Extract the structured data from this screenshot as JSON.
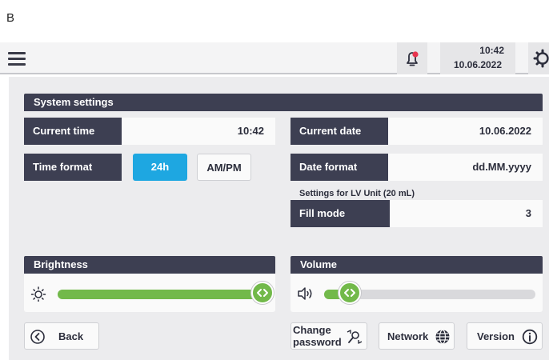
{
  "figure_label": "B",
  "header": {
    "time": "10:42",
    "date": "10.06.2022",
    "icons": [
      "menu-icon",
      "notification-bell-icon",
      "settings-gear-icon"
    ],
    "alert_color": "#e8344e"
  },
  "system_settings": {
    "title": "System settings",
    "current_time_label": "Current time",
    "current_time_value": "10:42",
    "current_date_label": "Current date",
    "current_date_value": "10.06.2022",
    "time_format_label": "Time format",
    "time_format_options": [
      "24h",
      "AM/PM"
    ],
    "time_format_selected": "24h",
    "date_format_label": "Date format",
    "date_format_value": "dd.MM.yyyy",
    "lv_note": "Settings for LV Unit (20 mL)",
    "fill_mode_label": "Fill mode",
    "fill_mode_value": "3"
  },
  "brightness": {
    "title": "Brightness",
    "level": 0.97,
    "icon": "sun-icon"
  },
  "volume": {
    "title": "Volume",
    "level": 0.12,
    "icon": "speaker-icon"
  },
  "footer": {
    "back_label": "Back",
    "change_password_line1": "Change",
    "change_password_line2": "password",
    "network_label": "Network",
    "version_label": "Version"
  },
  "colors": {
    "header_dark": "#3d3f52",
    "accent_blue": "#1ea7e1",
    "slider_green": "#72b94a",
    "panel_bg": "#ececee"
  }
}
